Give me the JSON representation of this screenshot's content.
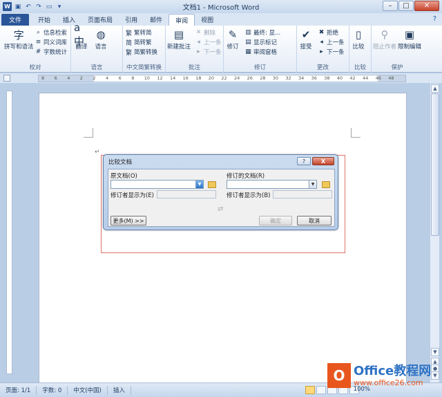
{
  "window": {
    "title": "文档1 - Microsoft Word"
  },
  "tabs": [
    "文件",
    "开始",
    "插入",
    "页面布局",
    "引用",
    "邮件",
    "审阅",
    "视图"
  ],
  "ribbon": {
    "proofing": {
      "label": "校对",
      "spelling": "拼写和语法",
      "research": "信息检索",
      "thesaurus": "同义词库",
      "wordcount": "字数统计"
    },
    "language": {
      "label": "语言",
      "translate": "翻译",
      "language": "语言"
    },
    "chinese": {
      "label": "中文简繁转换",
      "to_simplified": "繁转简",
      "to_traditional": "简转繁",
      "convert": "简繁转换"
    },
    "comments": {
      "label": "批注",
      "new": "新建批注",
      "delete": "删除",
      "previous": "上一条",
      "next": "下一条"
    },
    "tracking": {
      "label": "修订",
      "track": "修订",
      "final": "最终: 显...",
      "show_markup": "显示标记",
      "pane": "审阅窗格"
    },
    "changes": {
      "label": "更改",
      "accept": "接受",
      "reject": "拒绝",
      "previous": "上一条",
      "next": "下一条"
    },
    "compare": {
      "label": "比较",
      "compare": "比较"
    },
    "protect": {
      "label": "保护",
      "block_authors": "阻止作者",
      "restrict": "限制编辑"
    }
  },
  "ruler": {
    "numbers": [
      "8",
      "6",
      "4",
      "2",
      "2",
      "4",
      "6",
      "8",
      "10",
      "12",
      "14",
      "16",
      "18",
      "20",
      "22",
      "24",
      "26",
      "28",
      "30",
      "32",
      "34",
      "36",
      "38",
      "40",
      "42",
      "44",
      "46",
      "48"
    ]
  },
  "dialog": {
    "title": "比较文档",
    "help": "?",
    "close": "X",
    "original_label": "原文档(O)",
    "revised_label": "修订的文档(R)",
    "changes_by_left": "修订者显示为(E)",
    "changes_by_right": "修订者显示为(B)",
    "swap": "⇄",
    "more": "更多(M) >>",
    "ok": "确定",
    "cancel": "取消"
  },
  "status": {
    "page": "页面: 1/1",
    "words": "字数: 0",
    "language": "中文(中国)",
    "mode": "插入",
    "zoom": "100%"
  },
  "watermark": {
    "line1": "Office教程网",
    "line2": "www.office26.com"
  }
}
